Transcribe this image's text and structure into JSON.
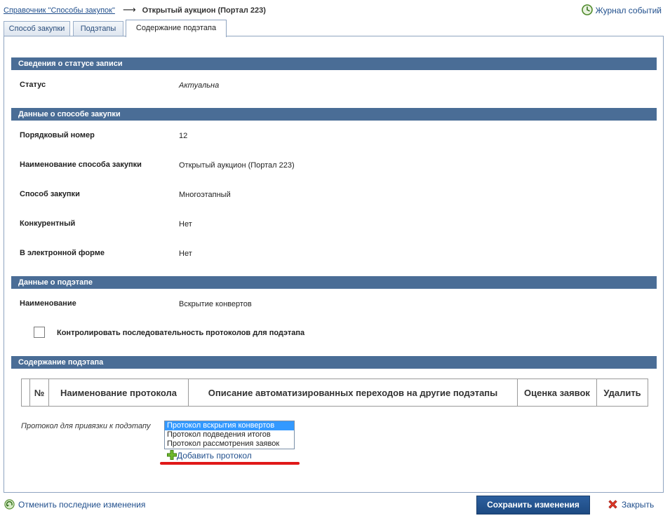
{
  "breadcrumb": {
    "parent": "Справочник \"Способы закупок\"",
    "arrow": "⟶",
    "current": "Открытый аукцион (Портал 223)"
  },
  "header": {
    "journal_label": "Журнал событий"
  },
  "tabs": [
    {
      "label": "Способ закупки",
      "active": false
    },
    {
      "label": "Подэтапы",
      "active": false
    },
    {
      "label": "Содержание подэтапа",
      "active": true
    }
  ],
  "sections": {
    "status": {
      "title": "Сведения о статусе записи",
      "fields": [
        {
          "label": "Статус",
          "value": "Актуальна"
        }
      ]
    },
    "method": {
      "title": "Данные о способе закупки",
      "fields": [
        {
          "label": "Порядковый номер",
          "value": "12"
        },
        {
          "label": "Наименование способа закупки",
          "value": "Открытый аукцион (Портал 223)"
        },
        {
          "label": "Способ закупки",
          "value": "Многоэтапный"
        },
        {
          "label": "Конкурентный",
          "value": "Нет"
        },
        {
          "label": "В электронной форме",
          "value": "Нет"
        }
      ]
    },
    "substage": {
      "title": "Данные о подэтапе",
      "fields": [
        {
          "label": "Наименование",
          "value": "Вскрытие конвертов"
        }
      ],
      "checkbox_label": "Контролировать последовательность протоколов для подэтапа",
      "checkbox_checked": false
    },
    "content": {
      "title": "Содержание подэтапа",
      "columns": [
        "№",
        "Наименование протокола",
        "Описание автоматизированных переходов на другие подэтапы",
        "Оценка заявок",
        "Удалить"
      ],
      "bind_label": "Протокол для привязки к подэтапу",
      "options": [
        "Протокол вскрытия конвертов",
        "Протокол подведения итогов",
        "Протокол рассмотрения заявок"
      ],
      "selected_index": 0,
      "add_label": "Добавить протокол"
    }
  },
  "footer": {
    "undo_label": "Отменить последние изменения",
    "save_label": "Сохранить изменения",
    "close_label": "Закрыть"
  },
  "colors": {
    "section_bar": "#4a6d96",
    "link": "#1f4e8c",
    "save_button": "#2c5f9e",
    "highlight_underline": "#e01818",
    "listbox_selected": "#3399ff"
  },
  "icons": [
    "clock-icon",
    "plus-icon",
    "undo-arrow-icon",
    "close-x-icon"
  ]
}
